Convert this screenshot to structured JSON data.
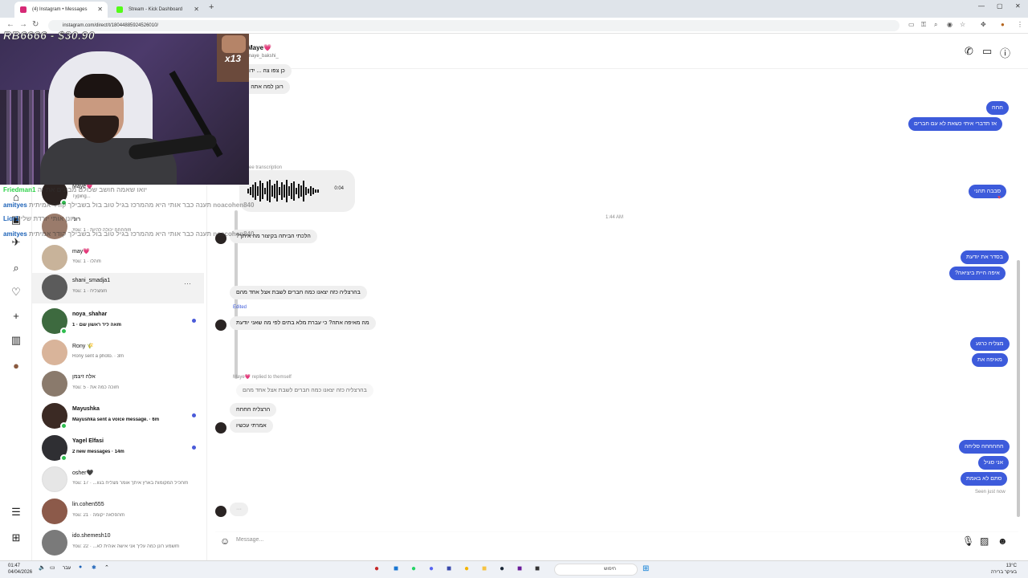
{
  "browser": {
    "tabs": [
      {
        "title": "(4) Instagram • Messages",
        "active": true,
        "favicon_color": "#d62976"
      },
      {
        "title": "Stream - Kick Dashboard",
        "active": false,
        "favicon_color": "#53fc18"
      }
    ],
    "url": "instagram.com/direct/t/18044885924526010/"
  },
  "stream_overlay": {
    "donation": "RB6666 - $30.90",
    "badge": "x13",
    "chat": [
      {
        "user": "Friedman1",
        "msg": "יואו שאמה חושב שכולם מבינים את זה"
      },
      {
        "user": "amityes",
        "msg": "תענה כבר אותי היא מהמרכז בגיל טוב בול בשבילך קודר אמיתית"
      },
      {
        "user": "Lior1",
        "msg": "רונן אותי יורדת שלי"
      },
      {
        "user": "amityes",
        "msg": "תענה כבר אותי היא מהמרכז בגיל טוב בול בשבילך קודר אמיתית"
      }
    ],
    "chat_mentions": [
      "noacohen840",
      "noacohen840"
    ]
  },
  "conversations": [
    {
      "name": "Maye💗",
      "preview": "Typing...",
      "time": "",
      "bold": false,
      "online": true,
      "unread": false,
      "avatar_color": "#2b2220"
    },
    {
      "name": "רוני",
      "preview": "You: חחחח יכולה להיות · 1m",
      "time": "",
      "bold": false,
      "online": false,
      "unread": false,
      "avatar_color": "#9a7b6b"
    },
    {
      "name": "may💗",
      "preview": "You: הלו · 1m",
      "time": "",
      "bold": false,
      "online": false,
      "unread": false,
      "avatar_color": "#c8b39a"
    },
    {
      "name": "shani_smadja1",
      "preview": "You: מצליח · 1m",
      "time": "",
      "bold": false,
      "online": false,
      "unread": false,
      "avatar_color": "#5b5b5b",
      "hover": true
    },
    {
      "name": "noya_shahar",
      "preview": "אה ליד ראשון שם · 1m",
      "time": "",
      "bold": true,
      "online": true,
      "unread": true,
      "avatar_color": "#3d6a3f"
    },
    {
      "name": "Rony 🌾",
      "preview": "Rony sent a photo. · 3m",
      "time": "",
      "bold": false,
      "online": false,
      "unread": false,
      "avatar_color": "#d9b49a"
    },
    {
      "name": "אלה זיצמן",
      "preview": "You: וכה כמה את · 5m",
      "time": "",
      "bold": false,
      "online": false,
      "unread": false,
      "avatar_color": "#8a7a6c"
    },
    {
      "name": "Mayushka",
      "preview": "Mayushka sent a voice message. · 6m",
      "time": "",
      "bold": true,
      "online": true,
      "unread": true,
      "avatar_color": "#3b2a24"
    },
    {
      "name": "Yagel Elfasi",
      "preview": "2 new messages · 14m",
      "time": "",
      "bold": true,
      "online": true,
      "unread": true,
      "avatar_color": "#2f2f33"
    },
    {
      "name": "osher🖤",
      "preview": "You: חכיל המקומות בארץ איתך אומר מצליח בגוו... · 17m",
      "time": "",
      "bold": false,
      "online": false,
      "unread": false,
      "avatar_color": "#e6e6e6"
    },
    {
      "name": "lin.cohen555",
      "preview": "You: הפלאה יקומה · 21m",
      "time": "",
      "bold": false,
      "online": false,
      "unread": false,
      "avatar_color": "#8c5a4a"
    },
    {
      "name": "ido.shemesh10",
      "preview": "You: שמע רונן כמה עליך אני אישה אוהית לא... · 22m",
      "time": "",
      "bold": false,
      "online": false,
      "unread": false,
      "avatar_color": "#7a7a7a"
    }
  ],
  "chat": {
    "name": "Maye💗",
    "handle": "maye_bakshi_",
    "voice_duration": "0:04",
    "voice_note": "See transcription",
    "timestamp": "1:44 AM",
    "edited_label": "Edited",
    "reply_label": "Maye💗 replied to themself",
    "seen": "Seen just now",
    "typing": "···",
    "incoming_top": "רונן למה אתה פ",
    "incoming_top2": "כן צפו צה ... ידוע",
    "incoming": [
      "הלכתי הביתה בקיצור מה איתך?",
      "בהרצליה כזה יצאנו כמה חברים לשבת אצל אחד מהם",
      "מה מאיפה אתה? כי עברת מלא בתים לפי מה שאני יודעת"
    ],
    "quoted": "בהרצליה כזה יצאנו כמה חברים לשבת אצל אחד מהם",
    "incoming2": [
      "הרצליה חחחח",
      "אמרתי עכשיו"
    ],
    "outgoing1": [
      "חחח",
      "אז תדברי איתי כשאת לא עם חברים"
    ],
    "outgoing2": "סבבה תהני",
    "outgoing3": [
      "בסדר את יודעת",
      "איפה היית ביציאה?"
    ],
    "outgoing4": [
      "מצליח כרגע",
      "מאיפה את"
    ],
    "outgoing5": [
      "חחחחחח סליחה",
      "אני סגיל",
      "סתם לא באמת"
    ],
    "composer_placeholder": "Message..."
  },
  "taskbar": {
    "time": "01:47",
    "date": "04/04/2026",
    "search": "חיפוש",
    "weather": "13°C",
    "weather_desc": "בעיקר ברירה",
    "lang": "עבר"
  }
}
